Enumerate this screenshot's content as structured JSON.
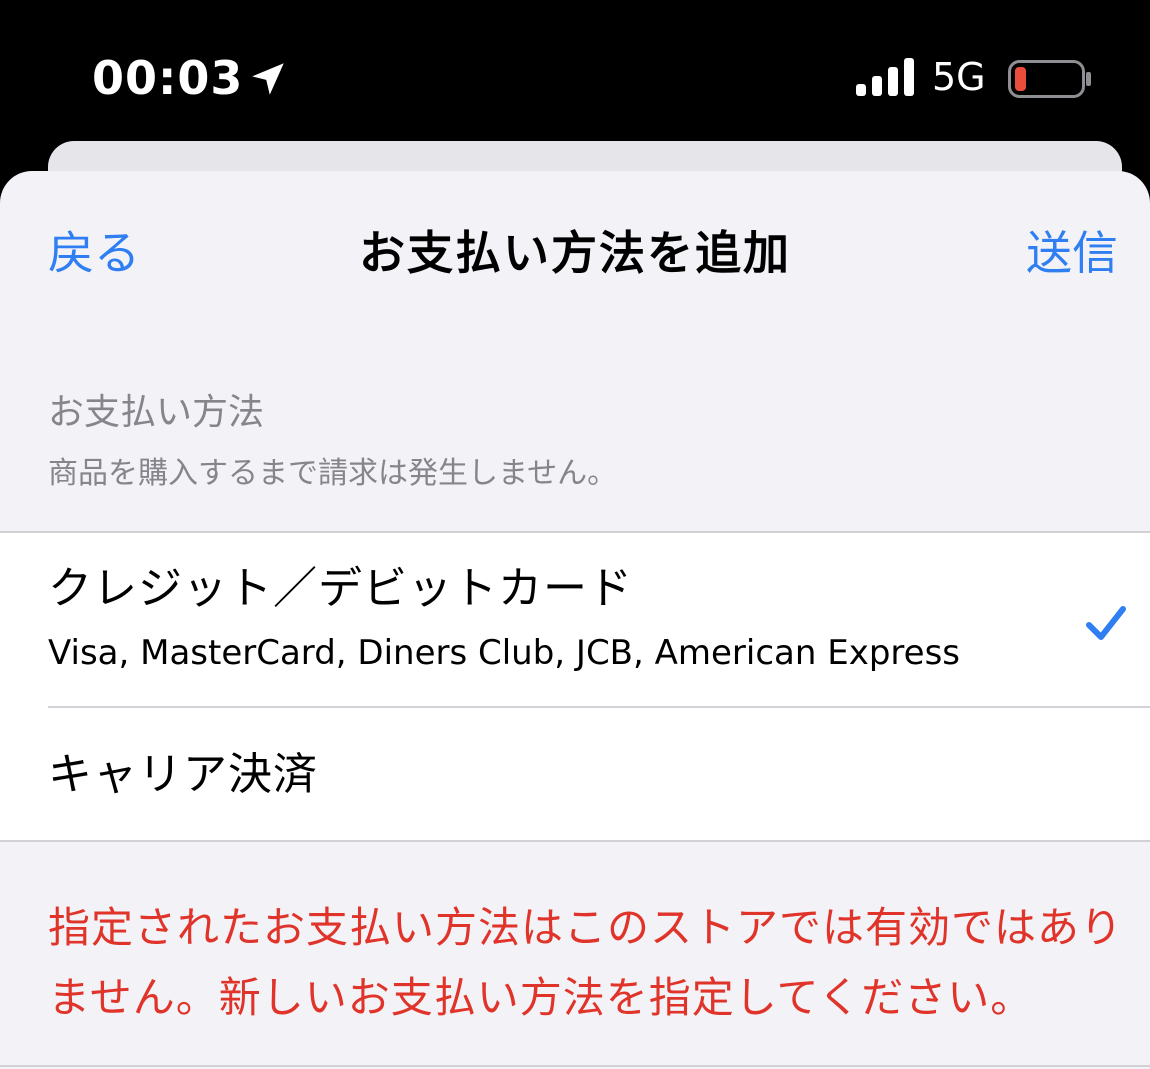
{
  "status_bar": {
    "time": "00:03",
    "network": "5G",
    "location_icon": "location-arrow-icon",
    "signal_icon": "signal-bars-icon",
    "battery_icon": "battery-low-icon",
    "battery_level_color": "#eb4d3d"
  },
  "nav": {
    "back_label": "戻る",
    "title": "お支払い方法を追加",
    "send_label": "送信"
  },
  "section": {
    "header": "お支払い方法",
    "subheader": "商品を購入するまで請求は発生しません。"
  },
  "payment_options": [
    {
      "title": "クレジット／デビットカード",
      "subtitle": "Visa, MasterCard, Diners Club, JCB, American Express",
      "selected": true
    },
    {
      "title": "キャリア決済",
      "selected": false
    }
  ],
  "error": {
    "message": "指定されたお支払い方法はこのストアでは有効ではありません。新しいお支払い方法を指定してください。"
  },
  "colors": {
    "accent": "#2f7ff3",
    "error": "#e0342a",
    "secondary_text": "#85858b",
    "grouped_background": "#f2f2f7"
  }
}
